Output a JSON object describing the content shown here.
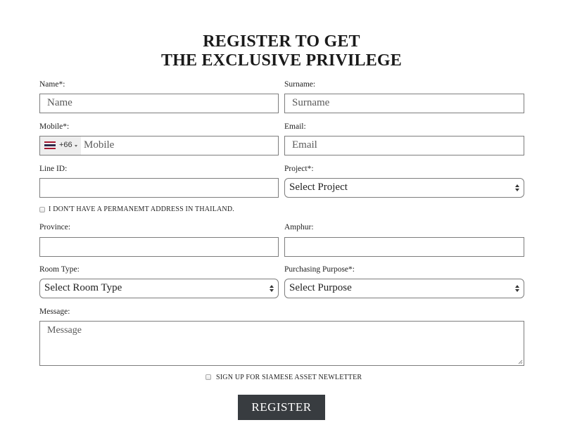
{
  "header": {
    "title_line1": "REGISTER TO GET",
    "title_line2": "THE EXCLUSIVE PRIVILEGE"
  },
  "form": {
    "name": {
      "label": "Name*:",
      "placeholder": "Name",
      "value": ""
    },
    "surname": {
      "label": "Surname:",
      "placeholder": "Surname",
      "value": ""
    },
    "mobile": {
      "label": "Mobile*:",
      "placeholder": "Mobile",
      "value": "",
      "country_flag": "thailand-flag-icon",
      "country_code": "+66",
      "flag_colors": [
        "#a51931",
        "#f4f5f8",
        "#2d2a4a",
        "#f4f5f8",
        "#a51931"
      ]
    },
    "email": {
      "label": "Email:",
      "placeholder": "Email",
      "value": ""
    },
    "line_id": {
      "label": "Line ID:",
      "placeholder": "",
      "value": ""
    },
    "project": {
      "label": "Project*:",
      "selected": "Select Project"
    },
    "no_address_checkbox": {
      "label": "I DON'T HAVE A PERMANEMT ADDRESS IN THAILAND.",
      "checked": false
    },
    "province": {
      "label": "Province:",
      "value": ""
    },
    "amphur": {
      "label": "Amphur:",
      "value": ""
    },
    "room_type": {
      "label": "Room Type:",
      "selected": "Select Room Type"
    },
    "purpose": {
      "label": "Purchasing Purpose*:",
      "selected": "Select Purpose"
    },
    "message": {
      "label": "Message:",
      "placeholder": "Message",
      "value": ""
    },
    "newsletter_checkbox": {
      "label": "SIGN UP FOR SIAMESE ASSET NEWLETTER",
      "checked": false
    },
    "submit_label": "REGISTER"
  }
}
